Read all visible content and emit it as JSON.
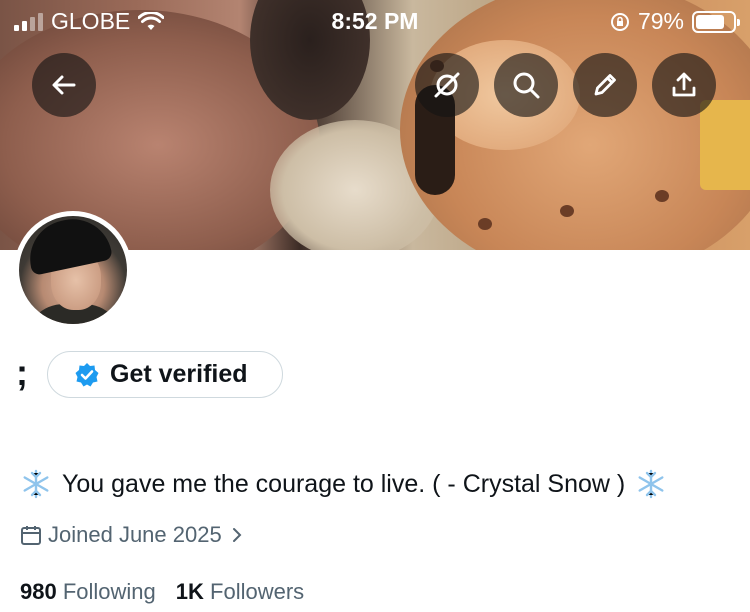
{
  "status_bar": {
    "carrier": "GLOBE",
    "time": "8:52 PM",
    "battery_percent": "79%",
    "battery_level": 0.79
  },
  "banner_actions": {
    "back": "back-arrow-icon",
    "items": [
      "grok-icon",
      "search-icon",
      "edit-pencil-icon",
      "share-upload-icon"
    ]
  },
  "profile": {
    "display_name": ";",
    "verify_label": "Get verified",
    "bio_emoji": "❄️",
    "bio_text": "You gave me the courage to live. ( - Crystal Snow )",
    "joined_text": "Joined June 2025",
    "following_count": "980",
    "following_label": "Following",
    "followers_count": "1K",
    "followers_label": "Followers"
  },
  "colors": {
    "accent_blue": "#1d9bf0",
    "text_primary": "#0f1419",
    "text_secondary": "#536471",
    "border": "#cfd9de",
    "snow_blue": "#8fc4ec"
  }
}
